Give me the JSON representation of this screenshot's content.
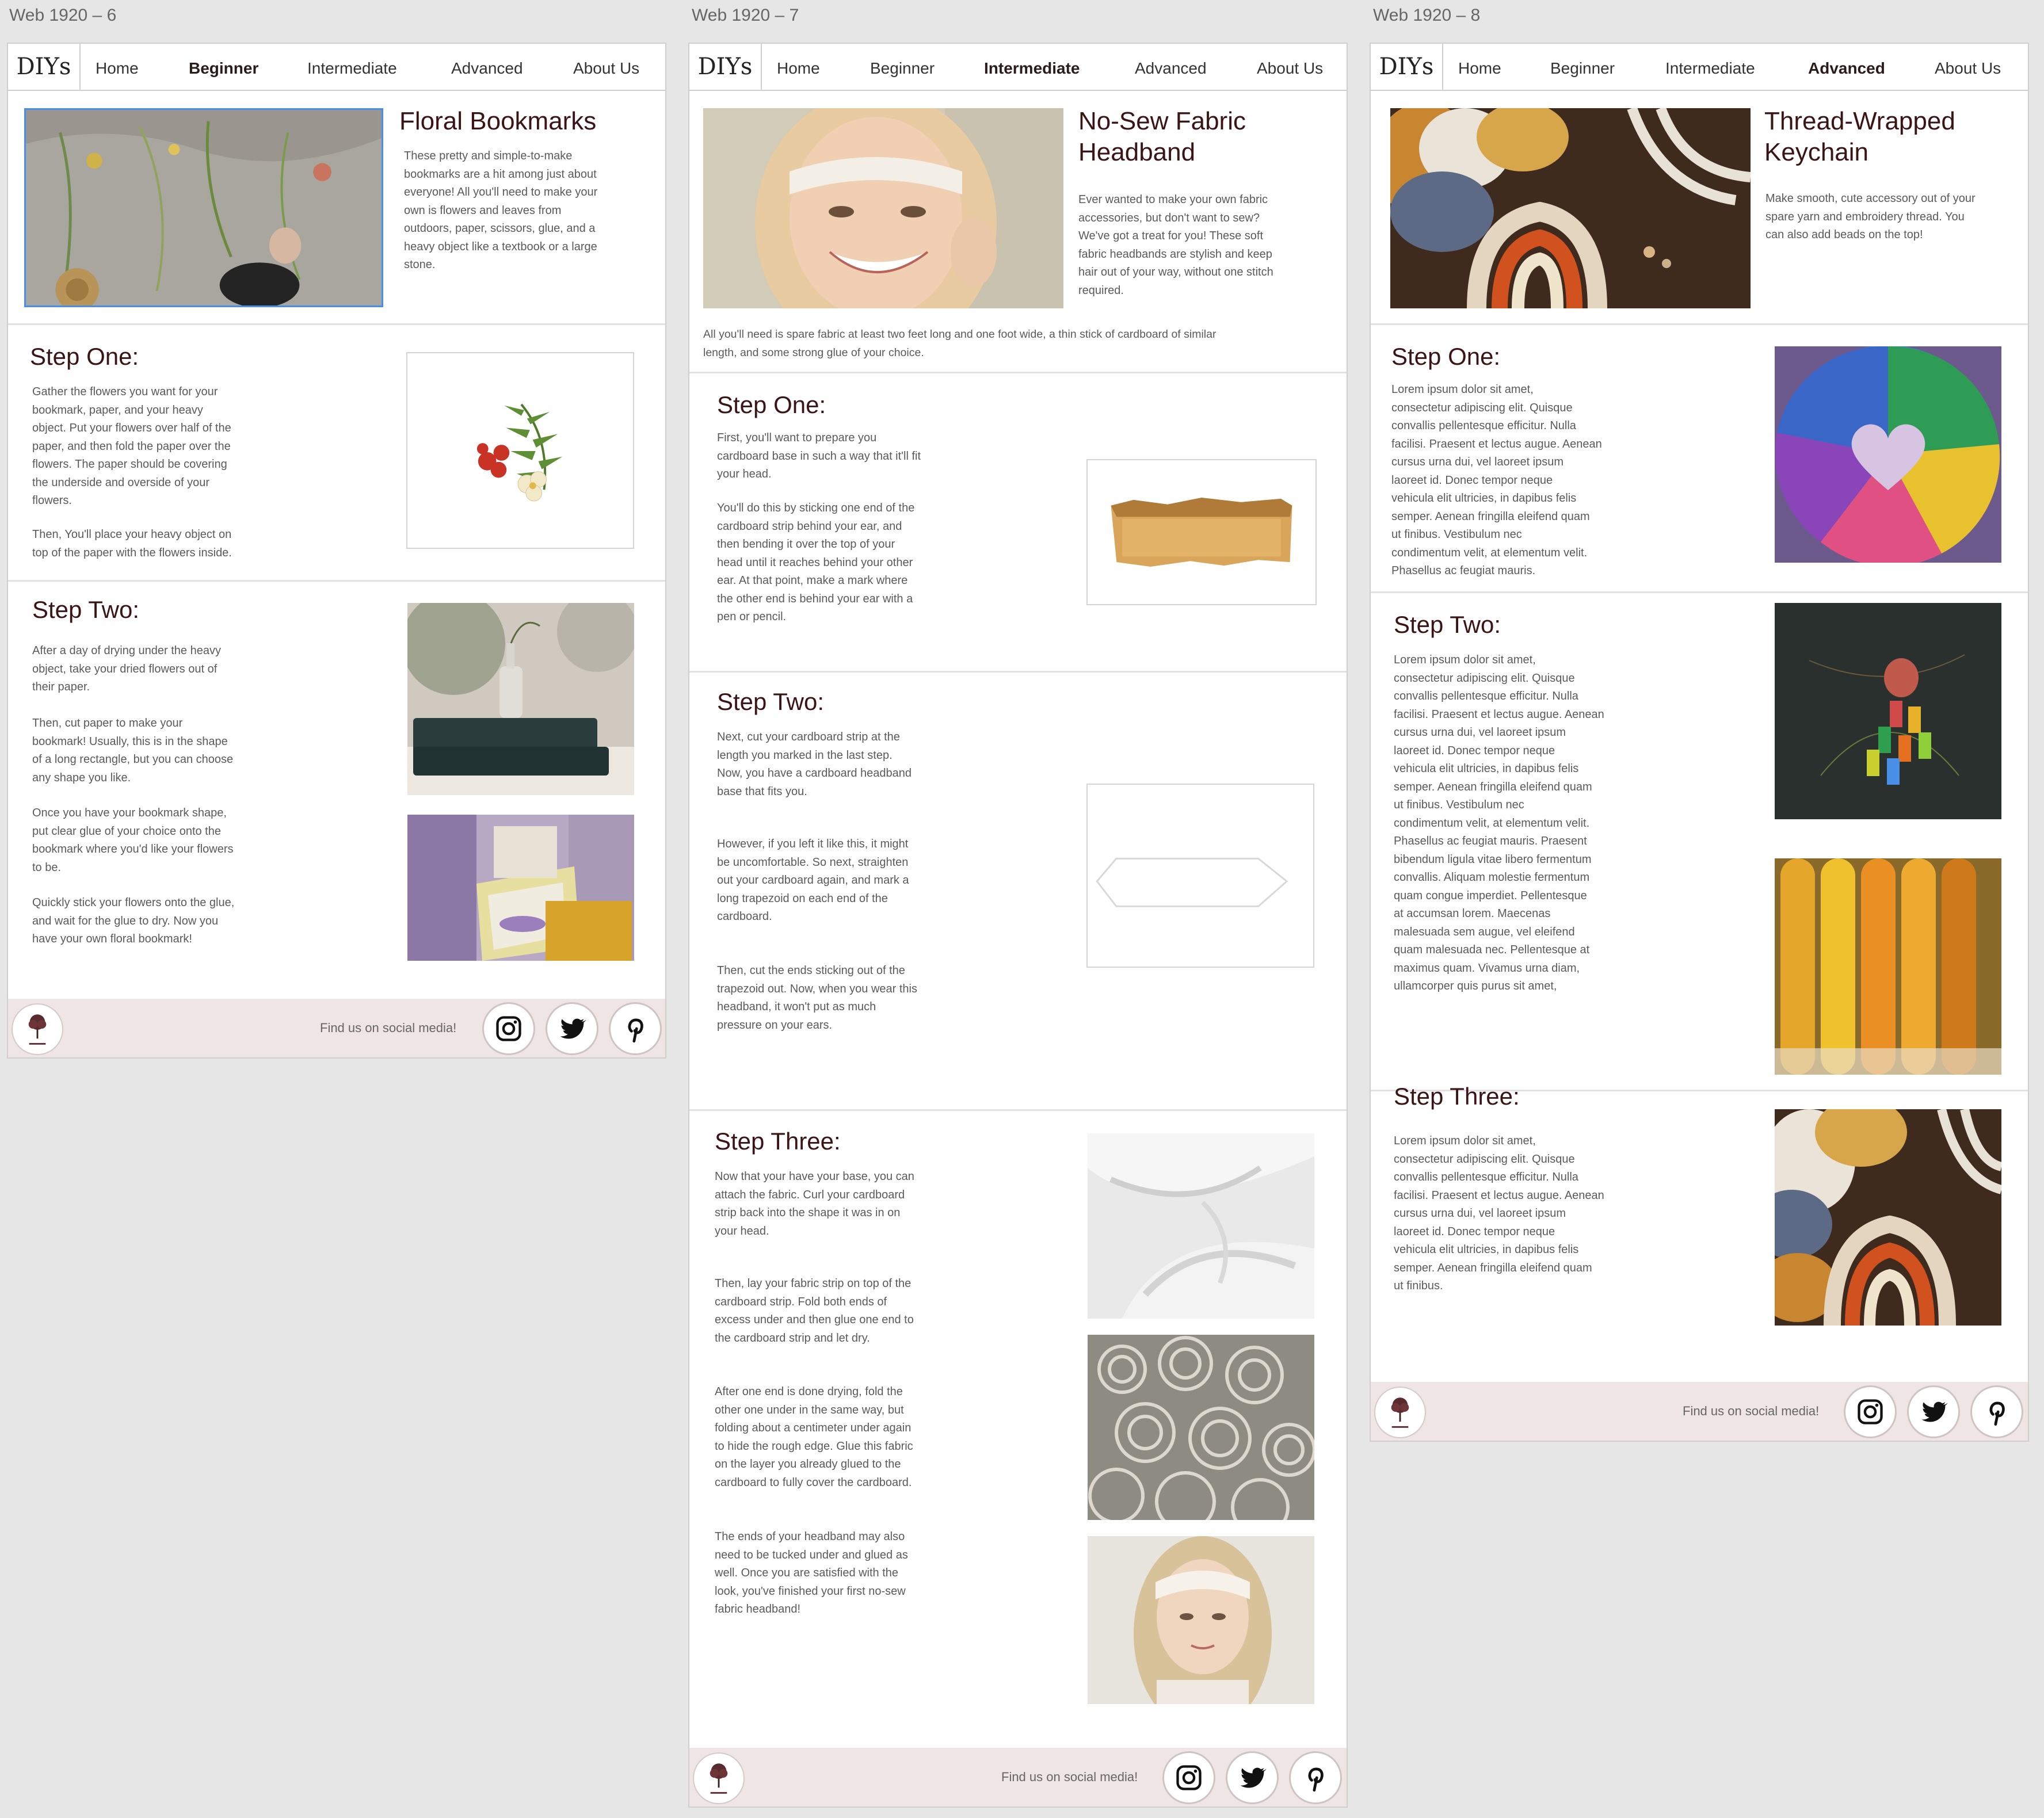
{
  "artboards": [
    {
      "name": "Web 1920 – 6",
      "nav": {
        "logo": "DIYs",
        "items": [
          "Home",
          "Beginner",
          "Intermediate",
          "Advanced",
          "About Us"
        ],
        "active": "Beginner"
      },
      "hero": {
        "title": "Floral Bookmarks",
        "text": "These pretty and simple-to-make\nbookmarks are a hit among just about\neveryone! All you'll need to make your\nown is flowers and leaves from\noutdoors, paper, scissors, glue, and a\nheavy object like a textbook or a large\nstone."
      },
      "steps": [
        {
          "title": "Step One:",
          "paragraphs": [
            "Gather the flowers you want for your\nbookmark, paper, and your heavy\nobject. Put your flowers over half of the\npaper, and then fold the paper over the\nflowers. The paper should be covering\nthe underside and overside of your\nflowers.",
            "Then, You'll place your heavy object on\ntop of the paper with the flowers inside."
          ]
        },
        {
          "title": "Step Two:",
          "paragraphs": [
            "After a day of drying under the heavy\nobject, take your dried flowers out of\ntheir paper.",
            "Then, cut paper to make your\nbookmark! Usually, this is in the shape\nof a long rectangle, but you can choose\nany shape you like.",
            "Once you have your bookmark shape,\nput clear glue of your choice onto the\nbookmark where you'd like your flowers\nto be.",
            "Quickly stick your flowers onto the glue,\nand wait for the glue to dry. Now you\nhave your own floral bookmark!"
          ]
        }
      ],
      "footer": {
        "text": "Find us on social media!"
      }
    },
    {
      "name": "Web 1920 – 7",
      "nav": {
        "logo": "DIYs",
        "items": [
          "Home",
          "Beginner",
          "Intermediate",
          "Advanced",
          "About Us"
        ],
        "active": "Intermediate"
      },
      "hero": {
        "title_line1": "No-Sew Fabric",
        "title_line2": "Headband",
        "text": "Ever wanted to make your own fabric\naccessories, but don't want to sew?\nWe've got a treat for you! These soft\nfabric headbands are stylish and keep\nhair out of your way, without one stitch\nrequired.",
        "supplies": "All you'll need is spare fabric at least two feet long and one foot wide, a thin stick of cardboard of similar\nlength, and some strong glue of your choice."
      },
      "steps": [
        {
          "title": "Step One:",
          "paragraphs": [
            "First, you'll want to prepare you\ncardboard base in such a way that it'll fit\nyour head.",
            "You'll do this by sticking one end of the\ncardboard strip behind your ear, and\nthen bending it over the top of your\nhead until it reaches behind your other\near. At that point, make a mark where\nthe other end is behind your ear with a\npen or pencil."
          ]
        },
        {
          "title": "Step Two:",
          "paragraphs": [
            "Next, cut your cardboard strip at the\nlength you marked in the last step.\nNow, you have a cardboard headband\nbase that fits you.",
            "However, if you left it like this, it might\nbe uncomfortable. So next, straighten\nout your cardboard again, and mark a\nlong trapezoid on each end of the\ncardboard.",
            "Then, cut the ends sticking out of the\ntrapezoid out. Now, when you wear this\nheadband, it won't put as much\npressure on your ears."
          ]
        },
        {
          "title": "Step Three:",
          "paragraphs": [
            "Now that your have your base, you can\nattach the fabric. Curl your cardboard\nstrip back into the shape it was in on\nyour head.",
            "Then, lay your fabric strip on top of the\ncardboard strip. Fold both ends of\nexcess under and then glue one end to\nthe cardboard strip and let dry.",
            "After one end is done drying, fold the\nother one under in the same way, but\nfolding about a centimeter under again\nto hide the rough edge. Glue this fabric\non the layer you already glued to the\ncardboard to fully cover the cardboard.",
            "The ends of your headband may also\nneed to be tucked under and glued as\nwell. Once you are satisfied with the\nlook, you've finished your first no-sew\nfabric headband!"
          ]
        }
      ],
      "footer": {
        "text": "Find us on social media!"
      }
    },
    {
      "name": "Web 1920 – 8",
      "nav": {
        "logo": "DIYs",
        "items": [
          "Home",
          "Beginner",
          "Intermediate",
          "Advanced",
          "About Us"
        ],
        "active": "Advanced"
      },
      "hero": {
        "title_line1": "Thread-Wrapped",
        "title_line2": "Keychain",
        "text": "Make smooth, cute accessory out of your\nspare yarn and embroidery thread. You\ncan also add beads on the top!"
      },
      "steps": [
        {
          "title": "Step One:",
          "text": "Lorem ipsum dolor sit amet,\nconsectetur adipiscing elit. Quisque\nconvallis pellentesque efficitur. Nulla\nfacilisi. Praesent et lectus augue. Aenean\ncursus urna dui, vel laoreet ipsum\nlaoreet id. Donec tempor neque\nvehicula elit ultricies, in dapibus felis\nsemper. Aenean fringilla eleifend quam\nut finibus. Vestibulum nec\ncondimentum velit, at elementum velit.\nPhasellus ac feugiat mauris."
        },
        {
          "title": "Step Two:",
          "text": "Lorem ipsum dolor sit amet,\nconsectetur adipiscing elit. Quisque\nconvallis pellentesque efficitur. Nulla\nfacilisi. Praesent et lectus augue. Aenean\ncursus urna dui, vel laoreet ipsum\nlaoreet id. Donec tempor neque\nvehicula elit ultricies, in dapibus felis\nsemper. Aenean fringilla eleifend quam\nut finibus. Vestibulum nec\ncondimentum velit, at elementum velit.\nPhasellus ac feugiat mauris. Praesent\nbibendum ligula vitae libero fermentum\nconvallis. Aliquam molestie fermentum\nquam congue imperdiet. Pellentesque\nat accumsan lorem. Maecenas\nmalesuada sem augue, vel eleifend\nquam malesuada nec. Pellentesque at\nmaximus quam. Vivamus urna diam,\nullamcorper quis purus sit amet,"
        },
        {
          "title": "Step Three:",
          "text": "Lorem ipsum dolor sit amet,\nconsectetur adipiscing elit. Quisque\nconvallis pellentesque efficitur. Nulla\nfacilisi. Praesent et lectus augue. Aenean\ncursus urna dui, vel laoreet ipsum\nlaoreet id. Donec tempor neque\nvehicula elit ultricies, in dapibus felis\nsemper. Aenean fringilla eleifend quam\nut finibus."
        }
      ],
      "footer": {
        "text": "Find us on social media!"
      }
    }
  ],
  "social_icons": [
    "instagram-icon",
    "twitter-icon",
    "pinterest-icon"
  ],
  "colors": {
    "heading": "#3b1416",
    "footer_bg": "#efe5e5",
    "canvas": "#e6e6e6",
    "selection": "#4a8fe7"
  }
}
